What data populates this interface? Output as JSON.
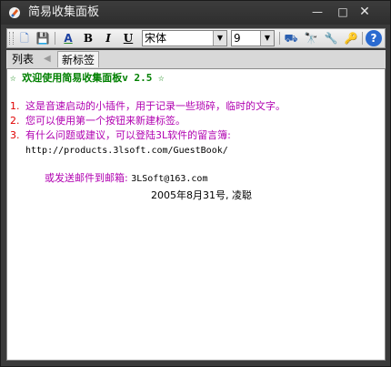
{
  "window": {
    "title": "简易收集面板"
  },
  "titlebar": {
    "minimize": "—",
    "maximize": "□",
    "close": "✕"
  },
  "toolbar": {
    "buttons": [
      {
        "name": "new-note-icon",
        "glyph": "🗋"
      },
      {
        "name": "save-icon",
        "glyph": "💾"
      },
      {
        "name": "font-color-icon",
        "glyph": "A"
      },
      {
        "name": "bold-icon",
        "glyph": "B"
      },
      {
        "name": "italic-icon",
        "glyph": "I"
      },
      {
        "name": "underline-icon",
        "glyph": "U"
      },
      {
        "name": "fill-icon",
        "glyph": "⛟"
      },
      {
        "name": "find-icon",
        "glyph": "🔭"
      },
      {
        "name": "tools-icon",
        "glyph": "🔧"
      },
      {
        "name": "key-icon",
        "glyph": "🔑"
      },
      {
        "name": "help-icon",
        "glyph": "?"
      }
    ],
    "font_name": "宋体",
    "font_size": "9"
  },
  "tabs": {
    "tab1": "列表",
    "tab2": "新标签"
  },
  "editor": {
    "heading": "☆ 欢迎使用简易收集面板v 2.5 ☆",
    "items": [
      {
        "num": "1.",
        "text": "这是音速启动的小插件，用于记录一些琐碎，临时的文字。"
      },
      {
        "num": "2.",
        "text": "您可以使用第一个按钮来新建标签。"
      },
      {
        "num": "3.",
        "text": "有什么问题或建议，可以登陆3L软件的留言簿:"
      }
    ],
    "url_line": "http://products.3lsoft.com/GuestBook/",
    "email_prefix": "或发送邮件到邮箱: ",
    "email": "3LSoft@163.com",
    "signature": "2005年8月31号, 凌聪"
  }
}
